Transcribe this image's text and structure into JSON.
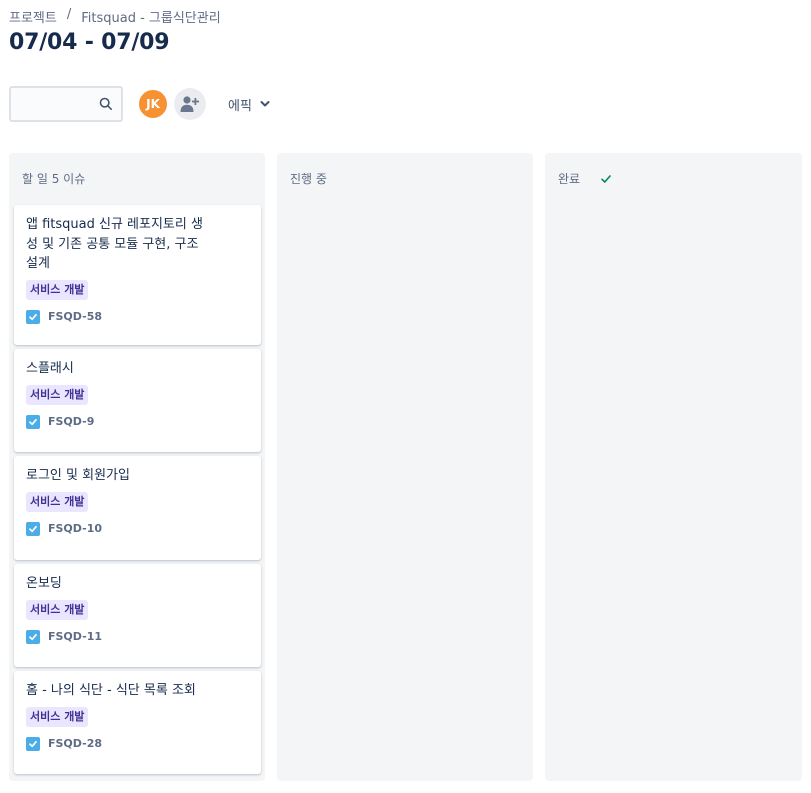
{
  "breadcrumb": {
    "project": "프로젝트",
    "separator": "/",
    "board": "Fitsquad - 그룹식단관리"
  },
  "page": {
    "title": "07/04 - 07/09"
  },
  "toolbar": {
    "search_value": "",
    "search_icon": "search-icon",
    "avatar_initials": "JK",
    "avatar_color": "#f79232",
    "add_member_icon": "add-person-icon",
    "epic_label": "에픽",
    "epic_icon": "chevron-down-icon"
  },
  "columns": [
    {
      "title": "할 일 5 이슈"
    },
    {
      "title": "진행 중"
    },
    {
      "title": "완료",
      "icon": "check-icon"
    }
  ],
  "cards": [
    {
      "summary": "앱 fitsquad 신규 레포지토리 생성 및 기존 공통 모듈 구현, 구조설계",
      "summary_lines": [
        "앱 fitsquad 신규 레포지토리 생",
        "성 및 기존 공통 모듈 구현, 구조",
        "설계"
      ],
      "label": "서비스 개발",
      "key": "FSQD-58",
      "type_icon": "task-checkbox-icon"
    },
    {
      "summary": "스플래시",
      "label": "서비스 개발",
      "key": "FSQD-9",
      "type_icon": "task-checkbox-icon"
    },
    {
      "summary": "로그인 및 회원가입",
      "label": "서비스 개발",
      "key": "FSQD-10",
      "type_icon": "task-checkbox-icon"
    },
    {
      "summary": "온보딩",
      "label": "서비스 개발",
      "key": "FSQD-11",
      "type_icon": "task-checkbox-icon"
    },
    {
      "summary": "홈 - 나의 식단 - 식단 목록 조회",
      "label": "서비스 개발",
      "key": "FSQD-28",
      "type_icon": "task-checkbox-icon"
    }
  ],
  "colors": {
    "label_bg": "#eae6ff",
    "label_text": "#403294",
    "task_icon": "#4bade8",
    "done_check": "#00875a",
    "column_bg": "#f4f5f7"
  }
}
